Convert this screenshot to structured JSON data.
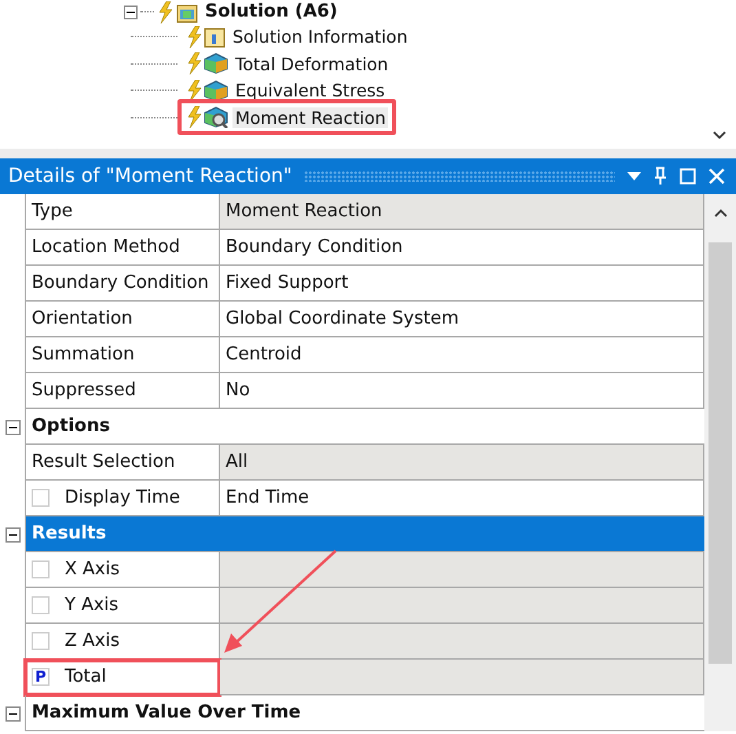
{
  "tree": {
    "root": {
      "label": "Solution (A6)",
      "expanded": true,
      "children": [
        {
          "label": "Solution Information",
          "kind": "info",
          "selected": false,
          "highlighted": false
        },
        {
          "label": "Total Deformation",
          "kind": "result",
          "selected": false,
          "highlighted": false
        },
        {
          "label": "Equivalent Stress",
          "kind": "result",
          "selected": false,
          "highlighted": false
        },
        {
          "label": "Moment Reaction",
          "kind": "probe",
          "selected": true,
          "highlighted": true
        }
      ]
    }
  },
  "details": {
    "title": "Details of \"Moment Reaction\"",
    "rows": [
      {
        "kind": "field",
        "label": "Type",
        "value": "Moment Reaction",
        "readonly": true
      },
      {
        "kind": "field",
        "label": "Location Method",
        "value": "Boundary Condition",
        "readonly": false
      },
      {
        "kind": "field",
        "label": "Boundary Condition",
        "value": "Fixed Support",
        "readonly": false
      },
      {
        "kind": "field",
        "label": "Orientation",
        "value": "Global Coordinate System",
        "readonly": false
      },
      {
        "kind": "field",
        "label": "Summation",
        "value": "Centroid",
        "readonly": false
      },
      {
        "kind": "field",
        "label": "Suppressed",
        "value": "No",
        "readonly": false
      },
      {
        "kind": "section",
        "label": "Options",
        "expanded": true,
        "selected": false
      },
      {
        "kind": "field",
        "label": "Result Selection",
        "value": "All",
        "readonly": true
      },
      {
        "kind": "check",
        "label": "Display Time",
        "value": "End Time",
        "readonly": false,
        "checked": false
      },
      {
        "kind": "section",
        "label": "Results",
        "expanded": true,
        "selected": true
      },
      {
        "kind": "check",
        "label": "X Axis",
        "readonly": true,
        "checked": false
      },
      {
        "kind": "check",
        "label": "Y Axis",
        "readonly": true,
        "checked": false
      },
      {
        "kind": "check",
        "label": "Z Axis",
        "readonly": true,
        "checked": false
      },
      {
        "kind": "parameter",
        "label": "Total",
        "marker": "P",
        "readonly": true,
        "highlighted": true
      },
      {
        "kind": "section",
        "label": "Maximum Value Over Time",
        "expanded": true,
        "selected": false
      }
    ]
  }
}
